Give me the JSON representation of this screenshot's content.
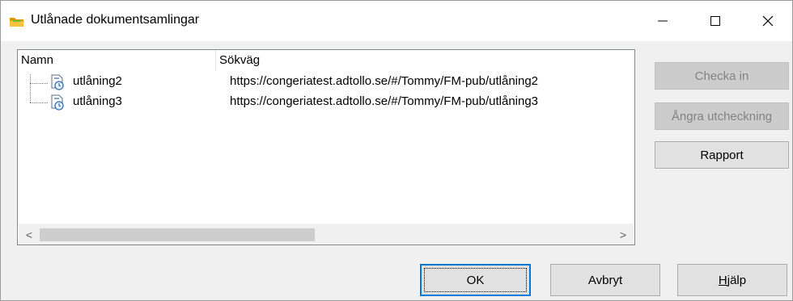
{
  "window": {
    "title": "Utlånade dokumentsamlingar",
    "title_icon": "folder-icon",
    "minimize": "—",
    "maximize": "☐",
    "close": "✕"
  },
  "list": {
    "columns": [
      "Namn",
      "Sökväg"
    ],
    "rows": [
      {
        "name": "utlåning2",
        "path": "https://congeriatest.adtollo.se/#/Tommy/FM-pub/utlåning2",
        "icon": "checked-out-document-icon"
      },
      {
        "name": "utlåning3",
        "path": "https://congeriatest.adtollo.se/#/Tommy/FM-pub/utlåning3",
        "icon": "checked-out-document-icon"
      }
    ],
    "scroll_left": "<",
    "scroll_right": ">"
  },
  "side_buttons": {
    "checkin": "Checka in",
    "undo_checkout": "Ångra utcheckning",
    "report": "Rapport"
  },
  "bottom_buttons": {
    "ok": "OK",
    "cancel": "Avbryt",
    "help_first": "H",
    "help_rest": "jälp"
  },
  "colors": {
    "accent": "#0078d7",
    "folder": "#f5b400"
  }
}
